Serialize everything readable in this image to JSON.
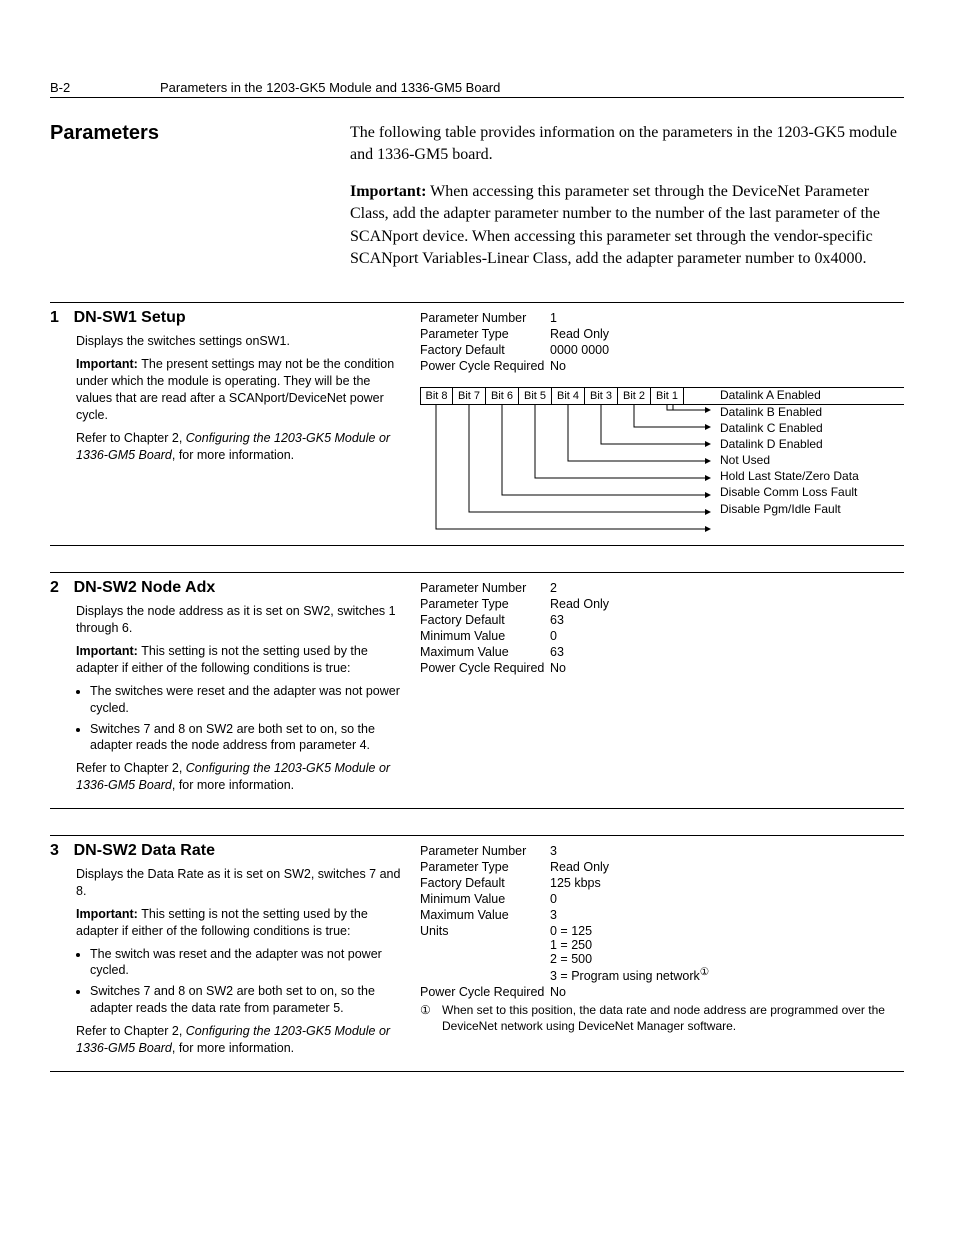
{
  "header": {
    "page_num": "B-2",
    "title": "Parameters in the 1203-GK5 Module and 1336-GM5 Board"
  },
  "section_title": "Parameters",
  "intro": {
    "p1": "The following table provides information on the parameters in the 1203-GK5 module and 1336-GM5 board.",
    "p2_label": "Important:",
    "p2": " When accessing this parameter set through the DeviceNet Parameter Class, add the adapter parameter number to the number of the last parameter of the SCANport device. When accessing this parameter set through the vendor-specific SCANport Variables-Linear Class, add the adapter parameter number to 0x4000."
  },
  "params": [
    {
      "num": "1",
      "title": "DN-SW1 Setup",
      "desc": "Displays the switches settings onSW1.",
      "important": "The present settings may not be the condition under which the module is operating. They will be the values that are read after a SCANport/DeviceNet power cycle.",
      "refer": "Refer to Chapter 2, ",
      "refer_em": "Configuring the 1203-GK5 Module or 1336-GM5 Board",
      "refer_tail": ", for more information.",
      "rows": [
        {
          "k": "Parameter Number",
          "v": "1"
        },
        {
          "k": "Parameter Type",
          "v": "Read Only"
        },
        {
          "k": "Factory Default",
          "v": "0000 0000"
        },
        {
          "k": "Power Cycle Required",
          "v": "No"
        }
      ],
      "bits": [
        "Bit 8",
        "Bit 7",
        "Bit 6",
        "Bit 5",
        "Bit 4",
        "Bit 3",
        "Bit 2",
        "Bit 1"
      ],
      "bit_labels": [
        "Datalink A Enabled",
        "Datalink B Enabled",
        "Datalink C Enabled",
        "Datalink D Enabled",
        "Not Used",
        "Hold Last State/Zero Data",
        "Disable Comm Loss Fault",
        "Disable Pgm/Idle Fault"
      ]
    },
    {
      "num": "2",
      "title": "DN-SW2 Node Adx",
      "desc": "Displays the node address as it is set on SW2, switches 1 through 6.",
      "important": "This setting is not the setting used by the adapter if either of the following conditions is true:",
      "bullets": [
        "The switches were reset and the adapter was not power cycled.",
        "Switches 7 and 8 on SW2 are both set to on, so the adapter reads the node address from parameter 4."
      ],
      "refer": "Refer to Chapter 2, ",
      "refer_em": "Configuring the 1203-GK5 Module or 1336-GM5 Board",
      "refer_tail": ", for more information.",
      "rows": [
        {
          "k": "Parameter Number",
          "v": "2"
        },
        {
          "k": "Parameter Type",
          "v": "Read Only"
        },
        {
          "k": "Factory Default",
          "v": "63"
        },
        {
          "k": "Minimum Value",
          "v": "0"
        },
        {
          "k": "Maximum Value",
          "v": "63"
        },
        {
          "k": "Power Cycle Required",
          "v": "No"
        }
      ]
    },
    {
      "num": "3",
      "title": "DN-SW2 Data Rate",
      "desc": "Displays the Data Rate as it is set on SW2, switches 7 and 8.",
      "important": "This setting is not the setting used by the adapter if either of the following conditions is true:",
      "bullets": [
        "The switch was reset and the adapter was not power cycled.",
        "Switches 7 and 8 on SW2 are both set to on, so the adapter reads the data rate from parameter 5."
      ],
      "refer": "Refer to Chapter 2, ",
      "refer_em": "Configuring the 1203-GK5 Module or 1336-GM5 Board",
      "refer_tail": ", for more information.",
      "rows": [
        {
          "k": "Parameter Number",
          "v": "3"
        },
        {
          "k": "Parameter Type",
          "v": "Read Only"
        },
        {
          "k": "Factory Default",
          "v": "125 kbps"
        },
        {
          "k": "Minimum Value",
          "v": "0"
        },
        {
          "k": "Maximum Value",
          "v": "3"
        }
      ],
      "units_label": "Units",
      "units_lines": [
        "0 = 125",
        "1 = 250",
        "2 = 500",
        "3 = Program using network"
      ],
      "units_sup": "①",
      "pcr": {
        "k": "Power Cycle Required",
        "v": "No"
      },
      "footnote_sym": "①",
      "footnote": "When set to this position, the data rate and node address are programmed over the DeviceNet network using DeviceNet Manager software."
    }
  ]
}
